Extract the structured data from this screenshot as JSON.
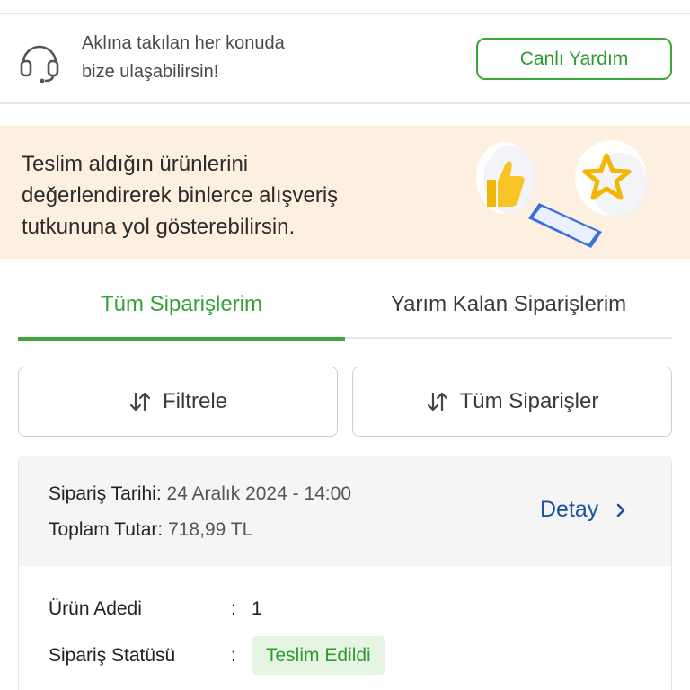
{
  "help": {
    "text_line1": "Aklına takılan her konuda",
    "text_line2": "bize ulaşabilirsin!",
    "button_label": "Canlı Yardım",
    "icon": "headset-icon"
  },
  "review_banner": {
    "line1": "Teslim aldığın ürünlerini",
    "line2": "değerlendirerek binlerce alışveriş",
    "line3": "tutkununa yol gösterebilirsin.",
    "illustration_icons": [
      "thumbs-up-icon",
      "star-icon",
      "phone-icon"
    ]
  },
  "tabs": [
    {
      "label": "Tüm Siparişlerim",
      "active": true
    },
    {
      "label": "Yarım Kalan Siparişlerim",
      "active": false
    }
  ],
  "filters": {
    "filter_label": "Filtrele",
    "orders_label": "Tüm Siparişler",
    "icon": "sort-arrows-icon"
  },
  "order": {
    "date_label": "Sipariş Tarihi:",
    "date_value": "24 Aralık 2024 - 14:00",
    "total_label": "Toplam Tutar:",
    "total_value": "718,99 TL",
    "detail_label": "Detay",
    "count_label": "Ürün Adedi",
    "count_value": "1",
    "status_label": "Sipariş Statüsü",
    "status_value": "Teslim Edildi",
    "separator": ":"
  },
  "colors": {
    "accent_green": "#3aa836",
    "link_blue": "#1f4fa0",
    "banner_bg": "#fdf0e0",
    "badge_bg": "#e6f4e3"
  }
}
